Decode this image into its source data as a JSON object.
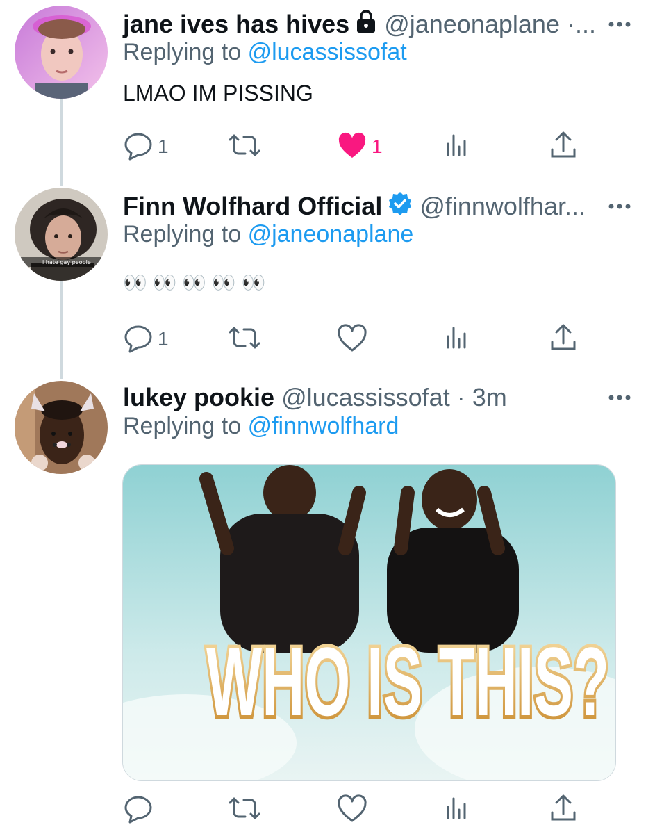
{
  "tweets": [
    {
      "name": "jane ives has hives",
      "handle": "@janeonaplane ·...",
      "replying_label": "Replying to",
      "replying_to": "@lucassissofat",
      "text": "LMAO IM PISSING",
      "reply_count": "1",
      "like_count": "1",
      "icons": [
        "lock-icon",
        "reply-icon",
        "retweet-icon",
        "heart-filled-icon",
        "stats-icon",
        "share-icon",
        "more-icon"
      ]
    },
    {
      "name": "Finn Wolfhard Official",
      "handle": "@finnwolfhar...",
      "replying_label": "Replying to",
      "replying_to": "@janeonaplane",
      "avatar_caption": "i hate gay people",
      "text": "👀 👀 👀 👀 👀",
      "reply_count": "1",
      "icons": [
        "verified-icon",
        "reply-icon",
        "retweet-icon",
        "heart-icon",
        "stats-icon",
        "share-icon",
        "more-icon"
      ]
    },
    {
      "name": "lukey pookie",
      "handle": "@lucassissofat · 3m",
      "replying_label": "Replying to",
      "replying_to": "@finnwolfhard",
      "image_text": "WHO IS THIS?",
      "icons": [
        "reply-icon",
        "retweet-icon",
        "heart-icon",
        "stats-icon",
        "share-icon",
        "more-icon"
      ]
    }
  ],
  "colors": {
    "link": "#1d9bf0",
    "secondary": "#536471",
    "like": "#f91880",
    "thread_line": "#cfd9de"
  }
}
